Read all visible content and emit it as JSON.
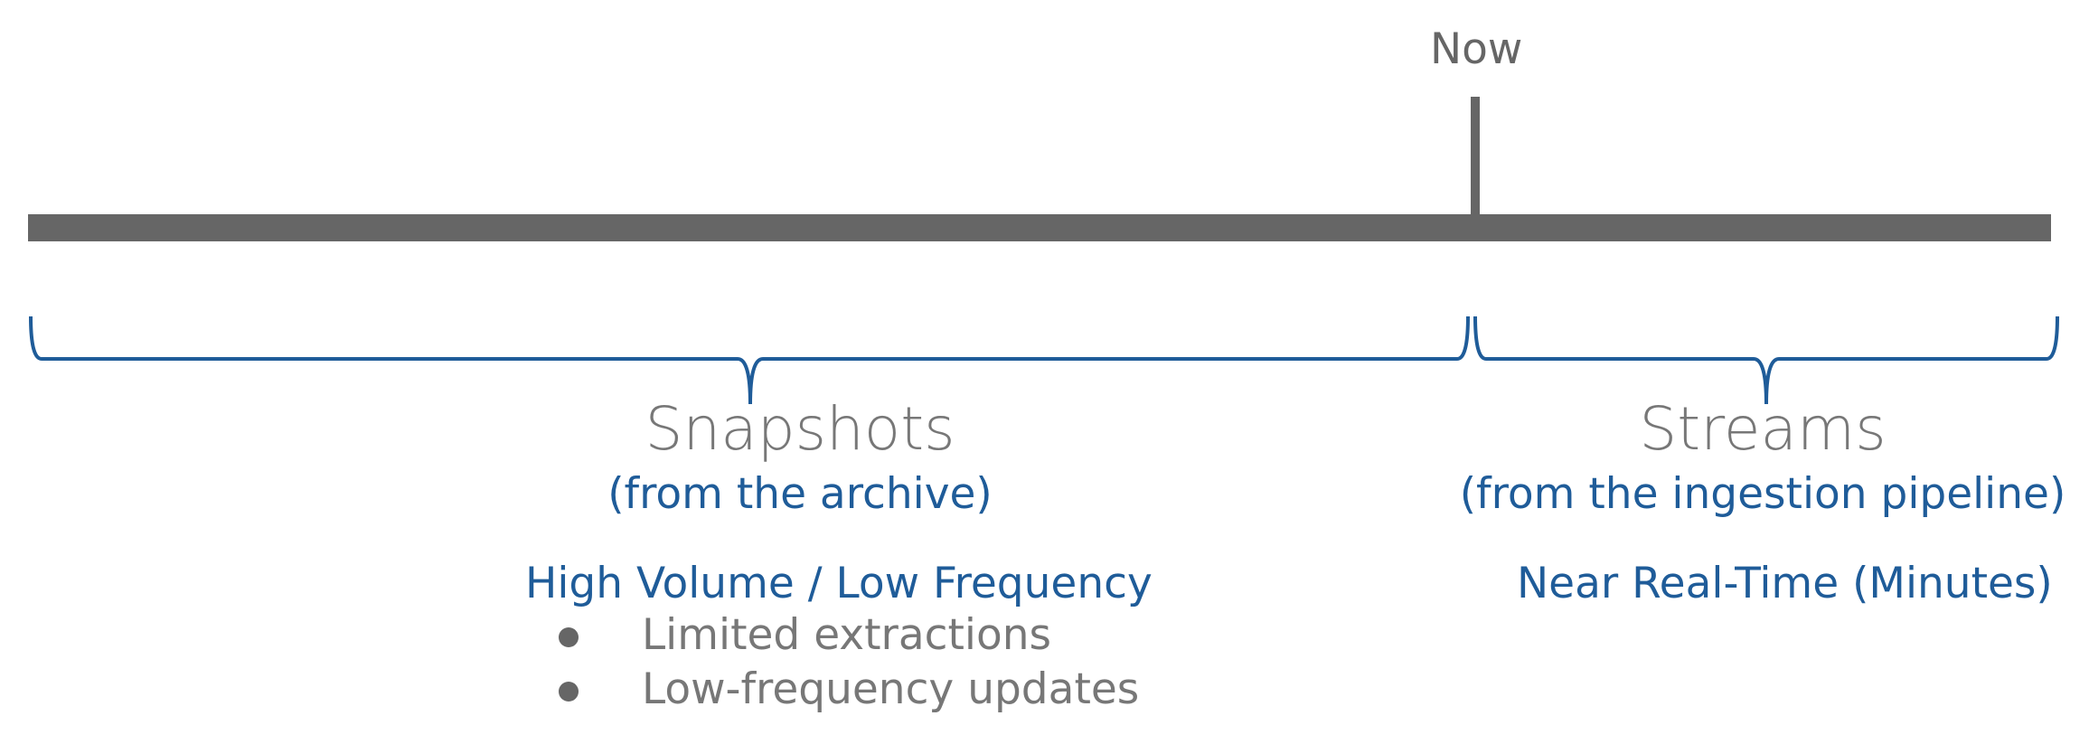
{
  "timeline": {
    "now_label": "Now"
  },
  "sections": [
    {
      "title": "Snapshots",
      "subtitle": "(from the archive)",
      "heading": "High Volume / Low Frequency",
      "bullets": [
        "Limited extractions",
        "Low-frequency updates"
      ]
    },
    {
      "title": "Streams",
      "subtitle": "(from the ingestion pipeline)",
      "heading": "Near Real-Time (Minutes)"
    }
  ],
  "colors": {
    "timeline": "#666666",
    "accent": "#1f5c99",
    "muted_text": "#777777"
  }
}
